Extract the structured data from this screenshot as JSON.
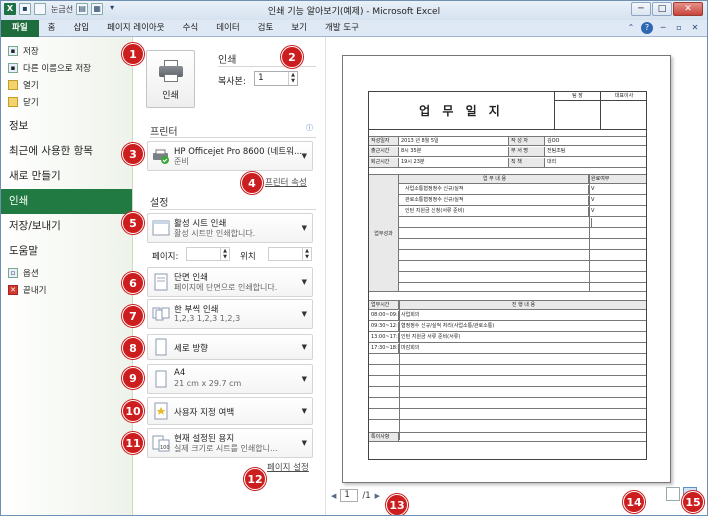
{
  "window": {
    "title": "인쇄 기능 알아보기(예제) - Microsoft Excel",
    "qat_label": "눈금선",
    "controls": [
      "─",
      "□",
      "✕"
    ]
  },
  "ribbon": {
    "tabs": [
      "파일",
      "홈",
      "삽입",
      "페이지 레이아웃",
      "수식",
      "데이터",
      "검토",
      "보기",
      "개발 도구"
    ]
  },
  "nav": {
    "commands_top": [
      {
        "label": "저장",
        "icon": "save-icon"
      },
      {
        "label": "다른 이름으로 저장",
        "icon": "save-as-icon"
      },
      {
        "label": "열기",
        "icon": "folder-icon"
      },
      {
        "label": "닫기",
        "icon": "folder-close-icon"
      }
    ],
    "categories": [
      "정보",
      "최근에 사용한 항목",
      "새로 만들기",
      "인쇄",
      "저장/보내기",
      "도움말"
    ],
    "active": "인쇄",
    "commands_bottom": [
      {
        "label": "옵션",
        "icon": "options-icon"
      },
      {
        "label": "끝내기",
        "icon": "exit-icon"
      }
    ]
  },
  "print": {
    "section_title": "인쇄",
    "print_button": "인쇄",
    "copies_label": "복사본:",
    "copies_value": "1"
  },
  "printer": {
    "section_title": "프린터",
    "name": "HP Officejet Pro 8600 (네트워...",
    "status": "준비",
    "properties_link": "프린터 속성"
  },
  "settings": {
    "section_title": "설정",
    "what": {
      "title": "활성 시트 인쇄",
      "sub": "활성 시트만 인쇄합니다."
    },
    "pages_label": "페이지:",
    "to_label": "위치",
    "sides": {
      "title": "단면 인쇄",
      "sub": "페이지에 단면으로 인쇄합니다."
    },
    "collate": {
      "title": "한 부씩 인쇄",
      "sub": "1,2,3    1,2,3    1,2,3"
    },
    "orientation": {
      "title": "세로 방향"
    },
    "paper": {
      "title": "A4",
      "sub": "21 cm x 29.7 cm"
    },
    "margins": {
      "title": "사용자 지정 여백"
    },
    "scaling": {
      "title": "현재 설정된 용지",
      "sub": "실제 크기로 시트를 인쇄합니..."
    },
    "page_setup_link": "페이지 설정"
  },
  "preview": {
    "sheet_title": "업 무 일 지",
    "approvals": [
      "팀 장",
      "대표이사"
    ],
    "info_rows": [
      [
        "작성일자",
        "2013 년 8월 5일",
        "작 성 자",
        "김OO"
      ],
      [
        "출근시간",
        "8시 35분",
        "부 서 명",
        "전팀조팀"
      ],
      [
        "퇴근시간",
        "19시 23분",
        "직    책",
        "대리"
      ]
    ],
    "section1_label": "업무성과",
    "section1_header": [
      "업 무 내 용",
      "완료여부"
    ],
    "section1_rows": [
      [
        "사업소통협정정수 신규/실적",
        "V"
      ],
      [
        "관로소통협정정수 신규/실적",
        "V"
      ],
      [
        "인턴 지원금 신청(서류 준비)",
        "V"
      ]
    ],
    "section2_header": [
      "업무시간",
      "진 행 내 용"
    ],
    "section2_rows": [
      [
        "08:00~09:30",
        "사업회의"
      ],
      [
        "09:30~12:00",
        "협정정수 신규/실적 처리(사업소통/관로소통)"
      ],
      [
        "13:00~17:30",
        "인턴 지원금 서류 준비(서류)"
      ],
      [
        "17:30~18:00",
        "마감회의"
      ]
    ],
    "note_label": "특이사항",
    "page_current": "1",
    "page_total": "/1"
  },
  "callouts": [
    "1",
    "2",
    "3",
    "4",
    "5",
    "6",
    "7",
    "8",
    "9",
    "10",
    "11",
    "12",
    "13",
    "14",
    "15"
  ]
}
